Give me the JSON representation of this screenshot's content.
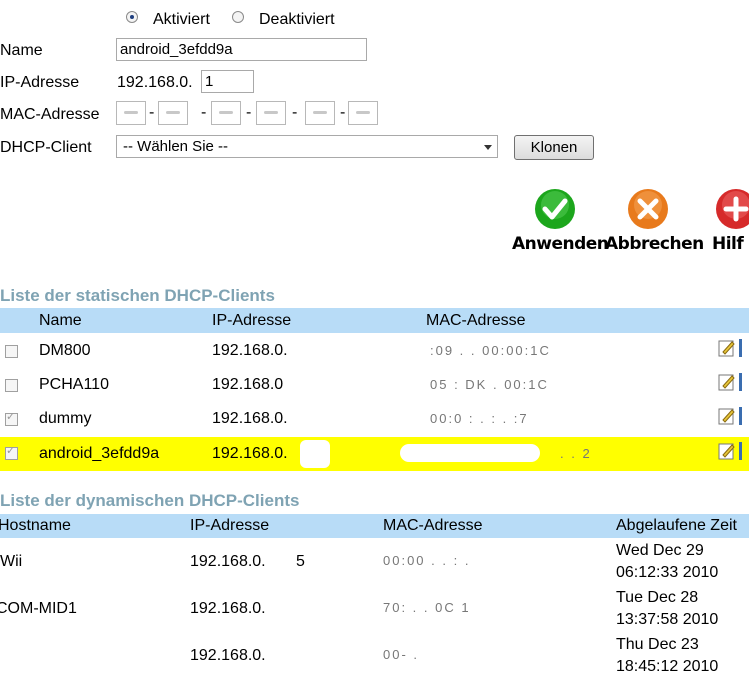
{
  "form": {
    "status": {
      "activated_label": "Aktiviert",
      "deactivated_label": "Deaktiviert",
      "selected": "Aktiviert"
    },
    "name_label": "Name",
    "name_value": "android_3efdd9a",
    "ip_label": "IP-Adresse",
    "ip_prefix": "192.168.0.",
    "ip_last_value": "1",
    "mac_label": "MAC-Adresse",
    "dhcp_client_label": "DHCP-Client",
    "dhcp_client_selected": "-- Wählen Sie --",
    "clone_button": "Klonen"
  },
  "actions": {
    "apply": {
      "label": "Anwenden",
      "color": "#1ca61c"
    },
    "cancel": {
      "label": "Abbrechen",
      "color": "#e87a1c"
    },
    "help": {
      "label": "Hilf",
      "color": "#d62a2a"
    }
  },
  "static_clients": {
    "title": "Liste der statischen DHCP-Clients",
    "headers": {
      "name": "Name",
      "ip": "IP-Adresse",
      "mac": "MAC-Adresse"
    },
    "rows": [
      {
        "name": "DM800",
        "ip": "192.168.0.",
        "mac": ":09 . . 00:00:1C",
        "checked": false,
        "highlighted": false
      },
      {
        "name": "PCHA110",
        "ip": "192.168.0",
        "mac": "05 : DK . 00:1C",
        "checked": false,
        "highlighted": false
      },
      {
        "name": "dummy",
        "ip": "192.168.0.",
        "mac": "00:0 : . : . :7",
        "checked": true,
        "highlighted": false
      },
      {
        "name": "android_3efdd9a",
        "ip": "192.168.0.",
        "mac": ". . 2",
        "checked": true,
        "highlighted": true
      }
    ],
    "highlight_color": "#ffff00",
    "header_color": "#b8dcf7"
  },
  "dynamic_clients": {
    "title": "Liste der dynamischen DHCP-Clients",
    "headers": {
      "hostname": "Hostname",
      "ip": "IP-Adresse",
      "mac": "MAC-Adresse",
      "expires": "Abgelaufene Zeit"
    },
    "rows": [
      {
        "hostname": "Wii",
        "ip": "192.168.0.",
        "ip_tail": "5",
        "mac": "00:00 . . : .",
        "expires_date": "Wed Dec 29",
        "expires_time": "06:12:33 2010"
      },
      {
        "hostname": "COM-MID1",
        "ip": "192.168.0.",
        "ip_tail": "",
        "mac": "70: . . 0C 1",
        "expires_date": "Tue Dec 28",
        "expires_time": "13:37:58 2010"
      },
      {
        "hostname": "",
        "ip": "192.168.0.",
        "ip_tail": "",
        "mac": "00- .",
        "expires_date": "Thu Dec 23",
        "expires_time": "18:45:12 2010"
      }
    ]
  }
}
